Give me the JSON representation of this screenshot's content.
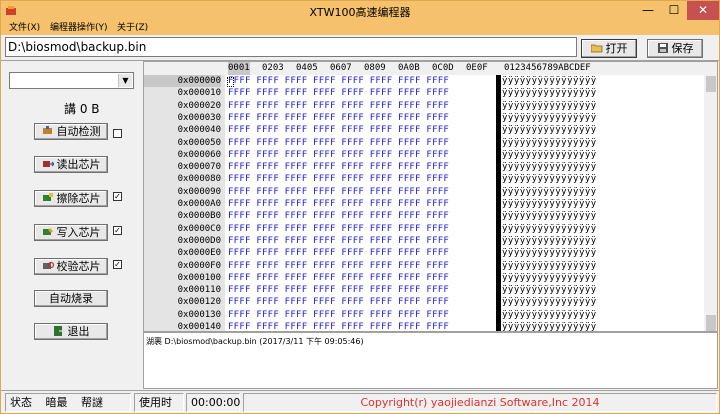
{
  "window": {
    "title": "XTW100高速编程器",
    "controls": {
      "minimize": "—",
      "maximize": "☐",
      "close": "✕"
    }
  },
  "menu": [
    {
      "label": "文件(X)"
    },
    {
      "label": "编程器操作(Y)"
    },
    {
      "label": "关于(Z)"
    }
  ],
  "file_path": "D:\\biosmod\\backup.bin",
  "toolbar": {
    "open_label": "打开",
    "save_label": "保存"
  },
  "left_panel": {
    "chip_select_value": "",
    "size_label": "講 0 B",
    "buttons": {
      "autodetect": "自动检测",
      "read": "读出芯片",
      "erase": "擦除芯片",
      "write": "写入芯片",
      "verify": "校验芯片",
      "autoburn": "自动烧录",
      "exit": "退出"
    },
    "checks": {
      "autodetect": "",
      "erase": "✓",
      "write": "✓",
      "verify": "✓"
    }
  },
  "hex_view": {
    "header_cells": [
      "0001",
      "0203",
      "0405",
      "0607",
      "0809",
      "0A0B",
      "0C0D",
      "0E0F",
      "0123456789ABCDEF"
    ],
    "rows": [
      {
        "address": "0x000000",
        "hex": "FFFF FFFF FFFF FFFF FFFF FFFF FFFF FFFF",
        "ascii": "ÿÿÿÿÿÿÿÿÿÿÿÿÿÿÿÿ"
      },
      {
        "address": "0x000010",
        "hex": "FFFF FFFF FFFF FFFF FFFF FFFF FFFF FFFF",
        "ascii": "ÿÿÿÿÿÿÿÿÿÿÿÿÿÿÿÿ"
      },
      {
        "address": "0x000020",
        "hex": "FFFF FFFF FFFF FFFF FFFF FFFF FFFF FFFF",
        "ascii": "ÿÿÿÿÿÿÿÿÿÿÿÿÿÿÿÿ"
      },
      {
        "address": "0x000030",
        "hex": "FFFF FFFF FFFF FFFF FFFF FFFF FFFF FFFF",
        "ascii": "ÿÿÿÿÿÿÿÿÿÿÿÿÿÿÿÿ"
      },
      {
        "address": "0x000040",
        "hex": "FFFF FFFF FFFF FFFF FFFF FFFF FFFF FFFF",
        "ascii": "ÿÿÿÿÿÿÿÿÿÿÿÿÿÿÿÿ"
      },
      {
        "address": "0x000050",
        "hex": "FFFF FFFF FFFF FFFF FFFF FFFF FFFF FFFF",
        "ascii": "ÿÿÿÿÿÿÿÿÿÿÿÿÿÿÿÿ"
      },
      {
        "address": "0x000060",
        "hex": "FFFF FFFF FFFF FFFF FFFF FFFF FFFF FFFF",
        "ascii": "ÿÿÿÿÿÿÿÿÿÿÿÿÿÿÿÿ"
      },
      {
        "address": "0x000070",
        "hex": "FFFF FFFF FFFF FFFF FFFF FFFF FFFF FFFF",
        "ascii": "ÿÿÿÿÿÿÿÿÿÿÿÿÿÿÿÿ"
      },
      {
        "address": "0x000080",
        "hex": "FFFF FFFF FFFF FFFF FFFF FFFF FFFF FFFF",
        "ascii": "ÿÿÿÿÿÿÿÿÿÿÿÿÿÿÿÿ"
      },
      {
        "address": "0x000090",
        "hex": "FFFF FFFF FFFF FFFF FFFF FFFF FFFF FFFF",
        "ascii": "ÿÿÿÿÿÿÿÿÿÿÿÿÿÿÿÿ"
      },
      {
        "address": "0x0000A0",
        "hex": "FFFF FFFF FFFF FFFF FFFF FFFF FFFF FFFF",
        "ascii": "ÿÿÿÿÿÿÿÿÿÿÿÿÿÿÿÿ"
      },
      {
        "address": "0x0000B0",
        "hex": "FFFF FFFF FFFF FFFF FFFF FFFF FFFF FFFF",
        "ascii": "ÿÿÿÿÿÿÿÿÿÿÿÿÿÿÿÿ"
      },
      {
        "address": "0x0000C0",
        "hex": "FFFF FFFF FFFF FFFF FFFF FFFF FFFF FFFF",
        "ascii": "ÿÿÿÿÿÿÿÿÿÿÿÿÿÿÿÿ"
      },
      {
        "address": "0x0000D0",
        "hex": "FFFF FFFF FFFF FFFF FFFF FFFF FFFF FFFF",
        "ascii": "ÿÿÿÿÿÿÿÿÿÿÿÿÿÿÿÿ"
      },
      {
        "address": "0x0000E0",
        "hex": "FFFF FFFF FFFF FFFF FFFF FFFF FFFF FFFF",
        "ascii": "ÿÿÿÿÿÿÿÿÿÿÿÿÿÿÿÿ"
      },
      {
        "address": "0x0000F0",
        "hex": "FFFF FFFF FFFF FFFF FFFF FFFF FFFF FFFF",
        "ascii": "ÿÿÿÿÿÿÿÿÿÿÿÿÿÿÿÿ"
      },
      {
        "address": "0x000100",
        "hex": "FFFF FFFF FFFF FFFF FFFF FFFF FFFF FFFF",
        "ascii": "ÿÿÿÿÿÿÿÿÿÿÿÿÿÿÿÿ"
      },
      {
        "address": "0x000110",
        "hex": "FFFF FFFF FFFF FFFF FFFF FFFF FFFF FFFF",
        "ascii": "ÿÿÿÿÿÿÿÿÿÿÿÿÿÿÿÿ"
      },
      {
        "address": "0x000120",
        "hex": "FFFF FFFF FFFF FFFF FFFF FFFF FFFF FFFF",
        "ascii": "ÿÿÿÿÿÿÿÿÿÿÿÿÿÿÿÿ"
      },
      {
        "address": "0x000130",
        "hex": "FFFF FFFF FFFF FFFF FFFF FFFF FFFF FFFF",
        "ascii": "ÿÿÿÿÿÿÿÿÿÿÿÿÿÿÿÿ"
      },
      {
        "address": "0x000140",
        "hex": "FFFF FFFF FFFF FFFF FFFF FFFF FFFF FFFF",
        "ascii": "ÿÿÿÿÿÿÿÿÿÿÿÿÿÿÿÿ"
      }
    ]
  },
  "log": {
    "text": "湖裹 D:\\biosmod\\backup.bin (2017/3/11 下午 09:05:46)"
  },
  "status_bar": {
    "status_items": [
      "状态",
      "暗最",
      "帮謎"
    ],
    "time_label": "使用时间",
    "time_value": "00:00:00",
    "copyright": "Copyright(r) yaojiedianzi Software,Inc 2014"
  },
  "colors": {
    "title_bar": "#f5c16c",
    "hex_text": "#2020d0",
    "copyright": "#e03030",
    "close_button": "#c75050"
  }
}
